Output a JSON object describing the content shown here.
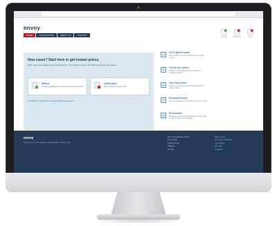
{
  "site": {
    "logo": "envoy",
    "nav": [
      "HOME",
      "YOUR QUOTES",
      "ABOUT US",
      "CONTACT"
    ]
  },
  "header_icons": [
    {
      "label": "Upload",
      "icon": "upload-icon",
      "color": "#5aa83a"
    },
    {
      "label": "Download",
      "icon": "download-icon",
      "color": "#c8262f"
    },
    {
      "label": "Excel",
      "icon": "excel-icon",
      "color": "#c8262f"
    }
  ],
  "hero": {
    "title": "New cases? Start here to get instant prices.",
    "description": "Enter your case details to get instant prices. You can then save, download or forward your cases.",
    "batch": {
      "title": "Batch",
      "description": "Upload a spreadsheet to get prices for several cases"
    },
    "individual": {
      "title": "Individual",
      "description": "Get a price for a single case"
    },
    "link": "Not Batch or Individual? Read the Batch template first."
  },
  "links": [
    {
      "title": "Get a quick quote",
      "description": "Get a guide for a simple case and one main person",
      "icon": "quote-icon"
    },
    {
      "title": "Check our prices",
      "description": "Request a spreadsheet of our prices for standard services",
      "icon": "prices-icon"
    },
    {
      "title": "Our new forms",
      "description": "See our new case documents and forms for getting started",
      "icon": "forms-icon"
    },
    {
      "title": "Forecast prices",
      "description": "Get a spreadsheet of future prices for next year",
      "icon": "forecast-icon"
    },
    {
      "title": "Reconsider",
      "description": "Request a review of a previous case and check if it can be done more cheaply",
      "icon": "reconsider-icon"
    }
  ],
  "footer": {
    "logo": "envoy",
    "tagline": "Envoy Ltd. is a U.K. company. Privacy Policy. Terms of use.",
    "col1": [
      "Envoy International Limited",
      "Dock House",
      "33 Dock Street",
      "Glasgow",
      "G1 1AB"
    ],
    "col2": [
      "Privacy policy",
      "Terms and conditions",
      "Accessibility",
      "Site map",
      "Contact us"
    ]
  },
  "colors": {
    "navy": "#243a58",
    "accent_red": "#b51f2c",
    "link_blue": "#2f75b5",
    "hero_bg": "#d9e8f1"
  }
}
